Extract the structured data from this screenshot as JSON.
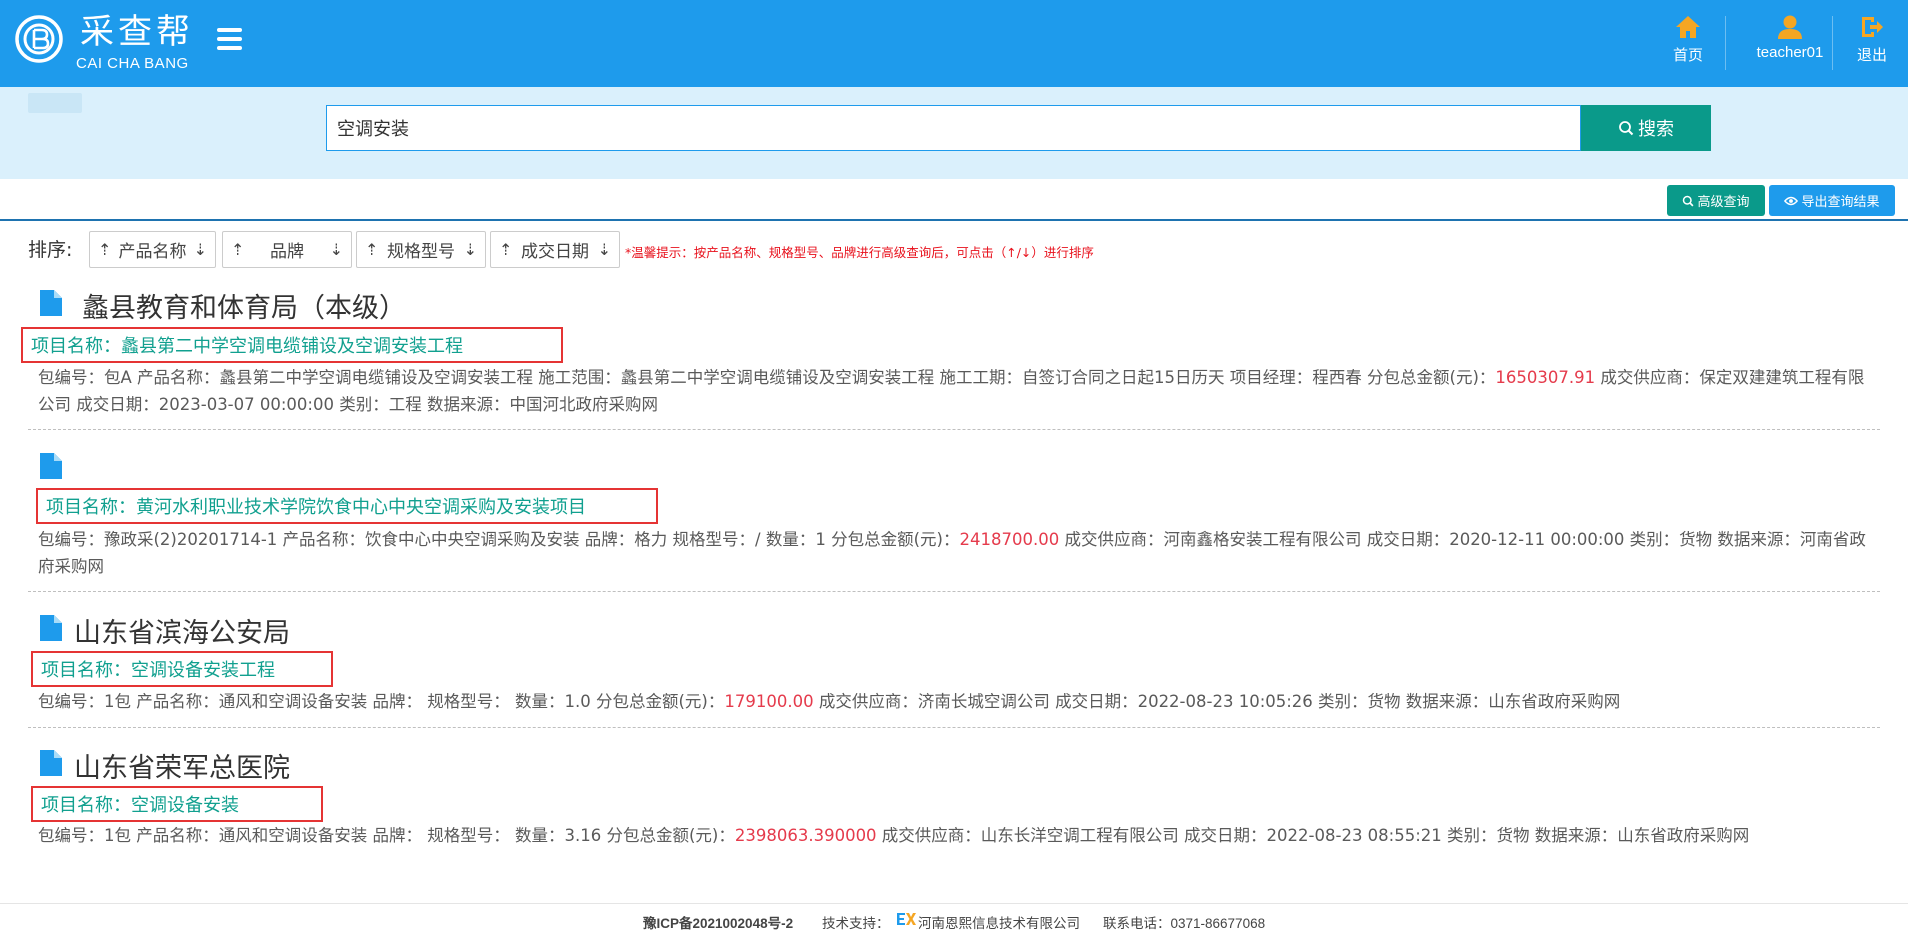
{
  "header": {
    "logo_cn": "采查帮",
    "logo_en": "CAI CHA BANG",
    "nav": {
      "home": "首页",
      "user": "teacher01",
      "exit": "退出"
    },
    "colors": {
      "bar": "#1e9bec",
      "icon_orange": "#f5a623"
    }
  },
  "search": {
    "value": "空调安装",
    "button": "搜索",
    "icon": "search-icon"
  },
  "toolbar": {
    "advanced": "高级查询",
    "export": "导出查询结果"
  },
  "sort": {
    "label": "排序:",
    "buttons": [
      {
        "up": "⇡",
        "label": "产品名称",
        "down": "⇣"
      },
      {
        "up": "⇡",
        "label": "品牌",
        "down": "⇣"
      },
      {
        "up": "⇡",
        "label": "规格型号",
        "down": "⇣"
      },
      {
        "up": "⇡",
        "label": "成交日期",
        "down": "⇣"
      }
    ],
    "hint": "*温馨提示：按产品名称、规格型号、品牌进行高级查询后，可点击（↑/↓）进行排序"
  },
  "results": [
    {
      "org": "蠡县教育和体育局（本级）",
      "project": "项目名称：蠡县第二中学空调电缆铺设及空调安装工程",
      "detail_pre": "包编号：包A  产品名称：蠡县第二中学空调电缆铺设及空调安装工程  施工范围：蠡县第二中学空调电缆铺设及空调安装工程  施工工期：自签订合同之日起15日历天  项目经理：程西春  分包总金额(元)：",
      "amount": "1650307.91",
      "detail_post": "  成交供应商：保定双建建筑工程有限公司  成交日期：2023-03-07 00:00:00  类别：工程  数据来源：中国河北政府采购网"
    },
    {
      "org": "",
      "project": "项目名称：黄河水利职业技术学院饮食中心中央空调采购及安装项目",
      "detail_pre": "包编号：豫政采(2)20201714-1  产品名称：饮食中心中央空调采购及安装  品牌：格力  规格型号：/  数量：1  分包总金额(元)：",
      "amount": "2418700.00",
      "detail_post": "  成交供应商：河南鑫格安装工程有限公司  成交日期：2020-12-11 00:00:00  类别：货物  数据来源：河南省政府采购网"
    },
    {
      "org": "山东省滨海公安局",
      "project": "项目名称：空调设备安装工程",
      "detail_pre": "包编号：1包  产品名称：通风和空调设备安装  品牌：   规格型号：   数量：1.0  分包总金额(元)：",
      "amount": "179100.00",
      "detail_post": "  成交供应商：济南长城空调公司  成交日期：2022-08-23 10:05:26  类别：货物  数据来源：山东省政府采购网"
    },
    {
      "org": "山东省荣军总医院",
      "project": "项目名称：空调设备安装",
      "detail_pre": "包编号：1包  产品名称：通风和空调设备安装  品牌：   规格型号：   数量：3.16  分包总金额(元)：",
      "amount": "2398063.390000",
      "detail_post": "  成交供应商：山东长洋空调工程有限公司  成交日期：2022-08-23 08:55:21  类别：货物  数据来源：山东省政府采购网"
    }
  ],
  "footer": {
    "icp": "豫ICP备2021002048号-2",
    "support_label": "技术支持：",
    "company": "河南恩熙信息技术有限公司",
    "phone": "联系电话：0371-86677068"
  }
}
